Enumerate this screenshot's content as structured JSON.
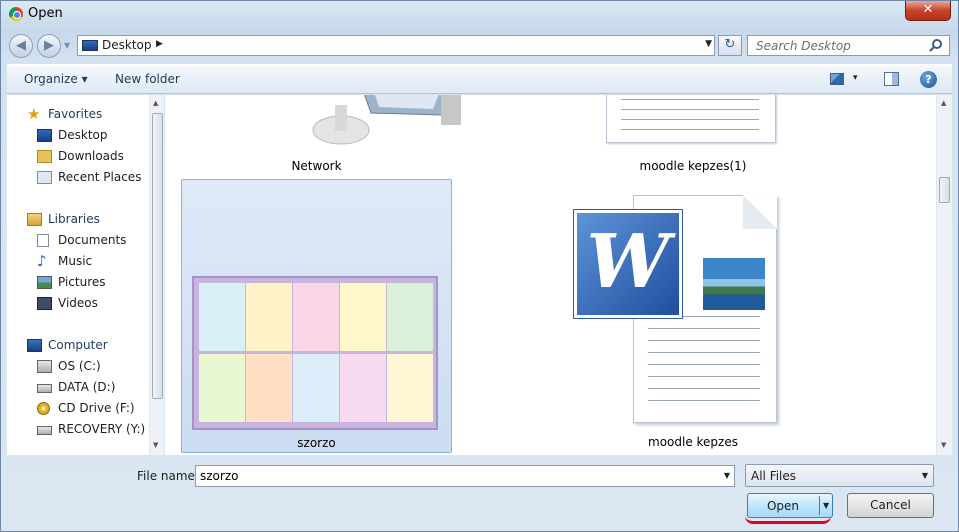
{
  "window": {
    "title": "Open",
    "close_label": "✕"
  },
  "navigation": {
    "back_label": "◀",
    "forward_label": "▶",
    "address": "Desktop",
    "crumb_arrow": "▶",
    "refresh_label": "↻",
    "search_placeholder": "Search Desktop"
  },
  "toolbar": {
    "organize_label": "Organize ▾",
    "new_folder_label": "New folder",
    "views_dropdown": "▾",
    "help_label": "?"
  },
  "sidebar": {
    "groups": [
      {
        "label": "Favorites",
        "icon": "star-icon"
      },
      {
        "label": "Desktop",
        "icon": "desktop-icon"
      },
      {
        "label": "Downloads",
        "icon": "downloads-icon"
      },
      {
        "label": "Recent Places",
        "icon": "recent-places-icon"
      },
      {
        "label": "Libraries",
        "icon": "libraries-icon"
      },
      {
        "label": "Documents",
        "icon": "documents-icon"
      },
      {
        "label": "Music",
        "icon": "music-icon"
      },
      {
        "label": "Pictures",
        "icon": "pictures-icon"
      },
      {
        "label": "Videos",
        "icon": "videos-icon"
      },
      {
        "label": "Computer",
        "icon": "computer-icon"
      },
      {
        "label": "OS (C:)",
        "icon": "drive-icon"
      },
      {
        "label": "DATA (D:)",
        "icon": "drive-icon"
      },
      {
        "label": "CD Drive (F:)",
        "icon": "cd-drive-icon"
      },
      {
        "label": "RECOVERY (Y:)",
        "icon": "drive-icon"
      }
    ]
  },
  "files": [
    {
      "name": "Network",
      "type": "network"
    },
    {
      "name": "moodle kepzes(1)",
      "type": "document"
    },
    {
      "name": "szorzo",
      "type": "image",
      "selected": true
    },
    {
      "name": "moodle kepzes",
      "type": "word-document"
    }
  ],
  "footer": {
    "filename_label": "File name:",
    "filename_value": "szorzo",
    "filter_value": "All Files",
    "open_label": "Open",
    "cancel_label": "Cancel"
  },
  "colors": {
    "accent": "#3c7fb1",
    "selection": "#cbdcf2",
    "annotation": "#e8001c"
  }
}
